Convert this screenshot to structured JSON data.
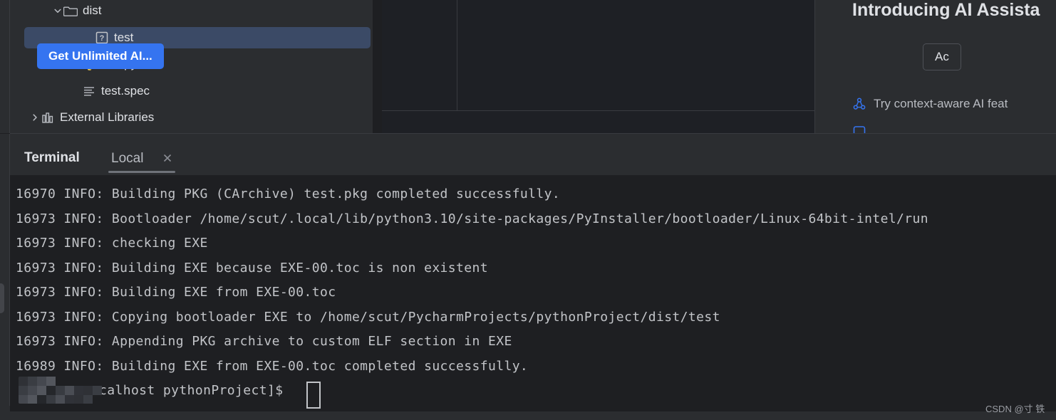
{
  "project_tree": {
    "items": [
      {
        "label": "dist",
        "icon": "folder-icon",
        "chevron": "chevron-down-icon",
        "indent": 60,
        "selected": false
      },
      {
        "label": "test",
        "icon": "unknown-file-icon",
        "chevron": "none",
        "indent": 104,
        "selected": true
      },
      {
        "label": "test.py",
        "icon": "python-file-icon",
        "chevron": "none",
        "indent": 86,
        "selected": false
      },
      {
        "label": "test.spec",
        "icon": "spec-file-icon",
        "chevron": "none",
        "indent": 86,
        "selected": false
      },
      {
        "label": "External Libraries",
        "icon": "library-icon",
        "chevron": "chevron-right-icon",
        "indent": 28,
        "selected": false
      }
    ],
    "selection_color": "#3b4a66"
  },
  "ai_panel": {
    "title": "Introducing AI Assista",
    "primary_button": "Get Unlimited AI...",
    "secondary_button": "Ac",
    "primary_color": "#3574f0",
    "features": [
      {
        "text": "Try context-aware AI feat",
        "icon": "ai-nodes-icon"
      },
      {
        "text": "",
        "icon": "chat-bubble-icon"
      }
    ]
  },
  "terminal": {
    "title": "Terminal",
    "tab_label": "Local",
    "close_icon": "close-icon",
    "lines": [
      "16970 INFO: Building PKG (CArchive) test.pkg completed successfully.",
      "16973 INFO: Bootloader /home/scut/.local/lib/python3.10/site-packages/PyInstaller/bootloader/Linux-64bit-intel/run",
      "16973 INFO: checking EXE",
      "16973 INFO: Building EXE because EXE-00.toc is non existent",
      "16973 INFO: Building EXE from EXE-00.toc",
      "16973 INFO: Copying bootloader EXE to /home/scut/PycharmProjects/pythonProject/dist/test",
      "16973 INFO: Appending PKG archive to custom ELF section in EXE",
      "16989 INFO: Building EXE from EXE-00.toc completed successfully."
    ],
    "prompt": "calhost pythonProject]$",
    "prompt_redacted": true,
    "cursor": "block-cursor"
  },
  "watermark": "CSDN @寸 铁"
}
